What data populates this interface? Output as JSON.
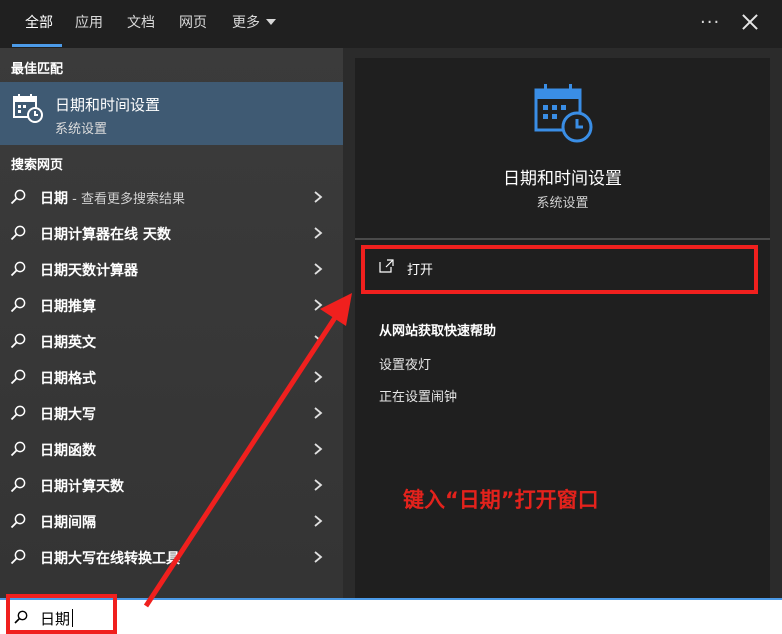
{
  "tabs": {
    "all": "全部",
    "apps": "应用",
    "docs": "文档",
    "web": "网页",
    "more": "更多"
  },
  "menu_dots": "···",
  "left": {
    "best_match_header": "最佳匹配",
    "best_match": {
      "title": "日期和时间设置",
      "subtitle": "系统设置"
    },
    "web_header": "搜索网页",
    "web_results": [
      {
        "bold": "日期",
        "rest": " - 查看更多搜索结果"
      },
      {
        "bold": "日期计算器在线 天数",
        "rest": ""
      },
      {
        "bold": "日期天数计算器",
        "rest": ""
      },
      {
        "bold": "日期推算",
        "rest": ""
      },
      {
        "bold": "日期英文",
        "rest": ""
      },
      {
        "bold": "日期格式",
        "rest": ""
      },
      {
        "bold": "日期大写",
        "rest": ""
      },
      {
        "bold": "日期函数",
        "rest": ""
      },
      {
        "bold": "日期计算天数",
        "rest": ""
      },
      {
        "bold": "日期间隔",
        "rest": ""
      },
      {
        "bold": "日期大写在线转换工具",
        "rest": ""
      }
    ]
  },
  "right": {
    "title": "日期和时间设置",
    "subtitle": "系统设置",
    "open_label": "打开",
    "help_title": "从网站获取快速帮助",
    "help_links": [
      "设置夜灯",
      "正在设置闹钟"
    ]
  },
  "search": {
    "value": "日期"
  },
  "annotation": "键入“日期”打开窗口",
  "colors": {
    "accent": "#4c9be8",
    "annotation_red": "#f0201e",
    "best_match_bg": "#3f5a73"
  },
  "icons": [
    "calendar-clock-icon",
    "search-icon",
    "chevron-right-icon",
    "open-external-icon",
    "close-icon",
    "more-dots-icon"
  ]
}
